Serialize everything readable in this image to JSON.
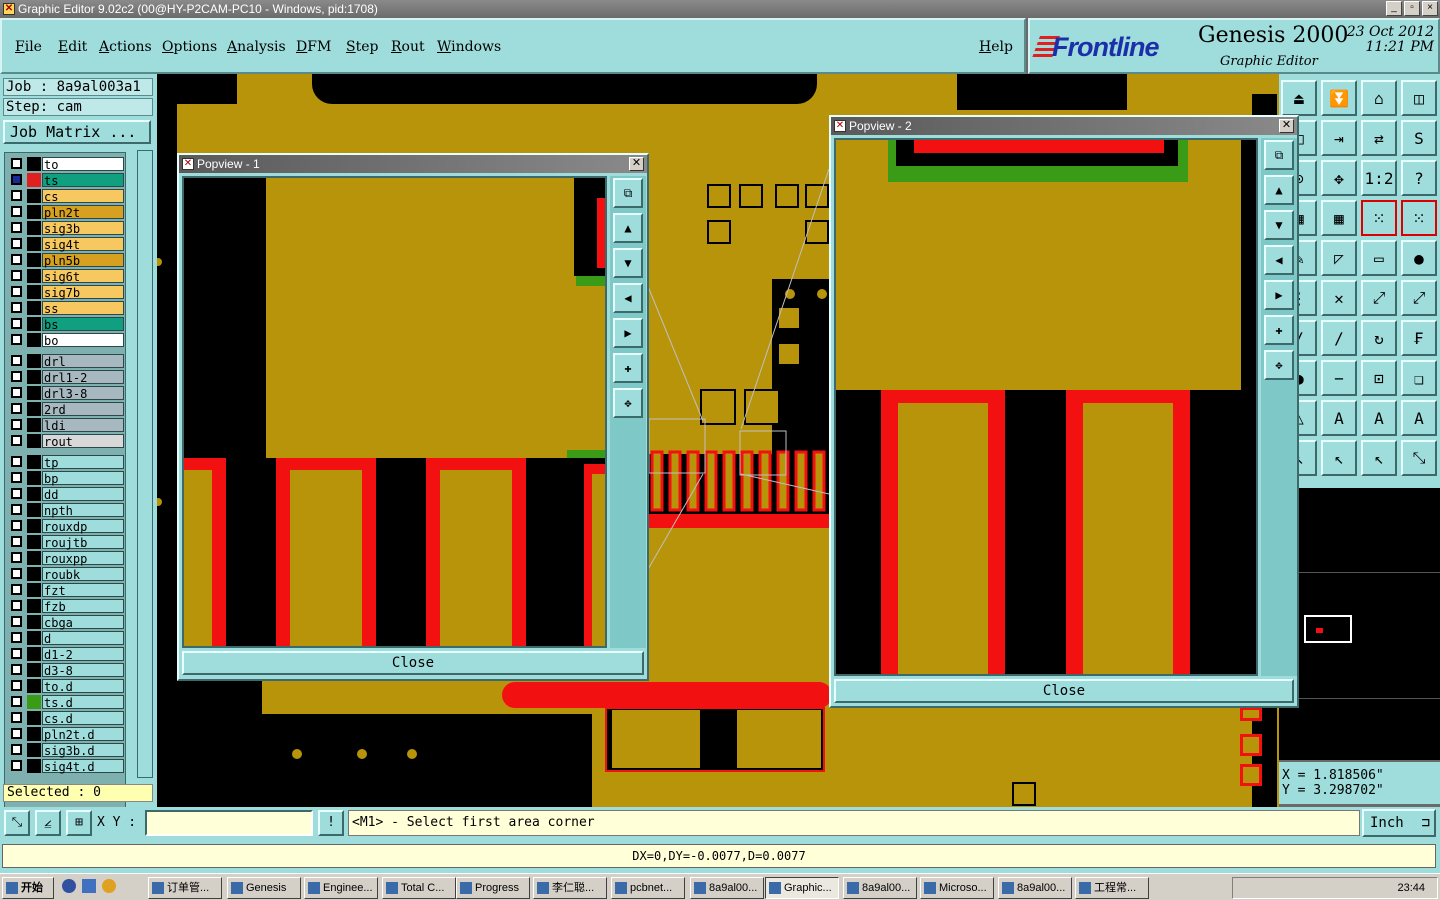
{
  "window": {
    "title": "Graphic Editor 9.02c2 (00@HY-P2CAM-PC10 - Windows, pid:1708)",
    "icon": "x-window-icon",
    "buttons": [
      "_",
      "▫",
      "×"
    ]
  },
  "menu": [
    {
      "label": "File"
    },
    {
      "label": "Edit"
    },
    {
      "label": "Actions"
    },
    {
      "label": "Options"
    },
    {
      "label": "Analysis"
    },
    {
      "label": "DFM"
    },
    {
      "label": "Step"
    },
    {
      "label": "Rout"
    },
    {
      "label": "Windows"
    },
    {
      "label": "Help"
    }
  ],
  "logo": {
    "brand": "Frontline",
    "product": "Genesis 2000",
    "subtitle": "Graphic Editor",
    "date": "23 Oct 2012",
    "time": "11:21 PM"
  },
  "job": {
    "job": "Job : 8a9al003a1",
    "step": "Step: cam",
    "matrix_button": "Job Matrix ..."
  },
  "layers": [
    {
      "name": "to",
      "color": "#ffffff",
      "swatch": "#000000"
    },
    {
      "name": "ts",
      "color": "#10a080",
      "swatch": "#e02020",
      "active": true
    },
    {
      "name": "cs",
      "color": "#f8c860",
      "swatch": "#000000"
    },
    {
      "name": "pln2t",
      "color": "#d8a020",
      "swatch": "#000000"
    },
    {
      "name": "sig3b",
      "color": "#f8c860",
      "swatch": "#000000"
    },
    {
      "name": "sig4t",
      "color": "#f8c860",
      "swatch": "#000000"
    },
    {
      "name": "pln5b",
      "color": "#d8a020",
      "swatch": "#000000"
    },
    {
      "name": "sig6t",
      "color": "#f8c860",
      "swatch": "#000000"
    },
    {
      "name": "sig7b",
      "color": "#f8c860",
      "swatch": "#000000"
    },
    {
      "name": "ss",
      "color": "#f8c860",
      "swatch": "#000000"
    },
    {
      "name": "bs",
      "color": "#10a080",
      "swatch": "#000000"
    },
    {
      "name": "bo",
      "color": "#ffffff",
      "swatch": "#000000"
    },
    {
      "name": "drl",
      "color": "#a8b8c0",
      "swatch": "#000000",
      "gap": true
    },
    {
      "name": "drl1-2",
      "color": "#a8b8c0",
      "swatch": "#000000"
    },
    {
      "name": "drl3-8",
      "color": "#a8b8c0",
      "swatch": "#000000"
    },
    {
      "name": "2rd",
      "color": "#a8b8c0",
      "swatch": "#000000"
    },
    {
      "name": "ldi",
      "color": "#a8b8c0",
      "swatch": "#000000"
    },
    {
      "name": "rout",
      "color": "#d8d8d8",
      "swatch": "#000000"
    },
    {
      "name": "tp",
      "color": "#9fdcdc",
      "swatch": "#000000",
      "gap": true
    },
    {
      "name": "bp",
      "color": "#9fdcdc",
      "swatch": "#000000"
    },
    {
      "name": "dd",
      "color": "#9fdcdc",
      "swatch": "#000000"
    },
    {
      "name": "npth",
      "color": "#9fdcdc",
      "swatch": "#000000"
    },
    {
      "name": "rouxdp",
      "color": "#9fdcdc",
      "swatch": "#000000"
    },
    {
      "name": "roujtb",
      "color": "#9fdcdc",
      "swatch": "#000000"
    },
    {
      "name": "rouxpp",
      "color": "#9fdcdc",
      "swatch": "#000000"
    },
    {
      "name": "roubk",
      "color": "#9fdcdc",
      "swatch": "#000000"
    },
    {
      "name": "fzt",
      "color": "#9fdcdc",
      "swatch": "#000000"
    },
    {
      "name": "fzb",
      "color": "#9fdcdc",
      "swatch": "#000000"
    },
    {
      "name": "cbga",
      "color": "#9fdcdc",
      "swatch": "#000000"
    },
    {
      "name": "d",
      "color": "#9fdcdc",
      "swatch": "#000000"
    },
    {
      "name": "d1-2",
      "color": "#9fdcdc",
      "swatch": "#000000"
    },
    {
      "name": "d3-8",
      "color": "#9fdcdc",
      "swatch": "#000000"
    },
    {
      "name": "to.d",
      "color": "#9fdcdc",
      "swatch": "#000000"
    },
    {
      "name": "ts.d",
      "color": "#9fdcdc",
      "swatch": "#3a9c16"
    },
    {
      "name": "cs.d",
      "color": "#9fdcdc",
      "swatch": "#000000"
    },
    {
      "name": "pln2t.d",
      "color": "#9fdcdc",
      "swatch": "#000000"
    },
    {
      "name": "sig3b.d",
      "color": "#9fdcdc",
      "swatch": "#000000"
    },
    {
      "name": "sig4t.d",
      "color": "#9fdcdc",
      "swatch": "#000000"
    }
  ],
  "selected": "Selected : 0",
  "popview1": {
    "title": "Popview - 1",
    "close": "Close"
  },
  "popview2": {
    "title": "Popview - 2",
    "close": "Close"
  },
  "coords": {
    "x": "X = 1.818506\"",
    "y": "Y = 3.298702\""
  },
  "bottom": {
    "xy_label": "X Y :",
    "xy_value": "",
    "info_button": "!",
    "prompt": "<M1> - Select first area corner",
    "units": "Inch"
  },
  "status": "DX=0,DY=-0.0077,D=0.0077",
  "taskbar": {
    "start": "开始",
    "tasks": [
      "订单管...",
      "Genesis",
      "Enginee...",
      "Total C...",
      "Progress",
      "李仁聪...",
      "pcbnet...",
      "8a9al00...",
      "Graphic...",
      "8a9al00...",
      "Microso...",
      "8a9al00...",
      "工程常..."
    ],
    "pressed_index": 8,
    "clock": "23:44"
  },
  "colors": {
    "copper": "#b8940a",
    "pad_outline": "#f31010",
    "panel": "#9fdcdc",
    "mask": "#3a9c16"
  }
}
